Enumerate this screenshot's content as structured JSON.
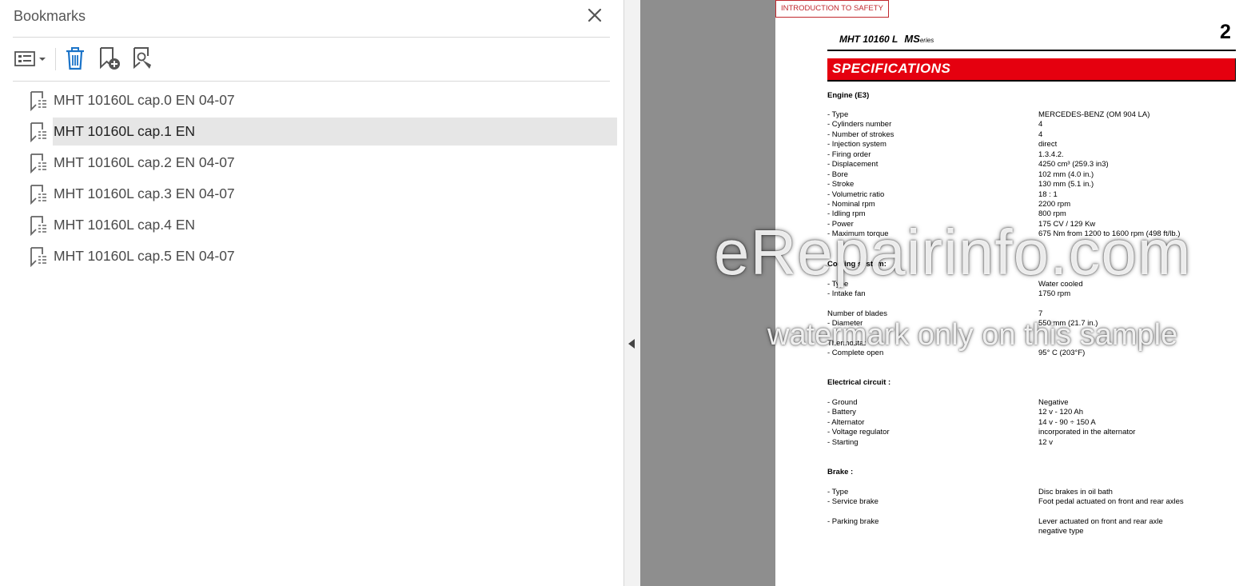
{
  "bookmarks_panel": {
    "title": "Bookmarks",
    "items": [
      {
        "label": "MHT 10160L cap.0 EN 04-07"
      },
      {
        "label": "MHT 10160L cap.1 EN"
      },
      {
        "label": "MHT 10160L cap.2 EN 04-07"
      },
      {
        "label": "MHT 10160L cap.3 EN 04-07"
      },
      {
        "label": "MHT 10160L cap.4 EN"
      },
      {
        "label": "MHT 10160L cap.5 EN 04-07"
      }
    ],
    "selected_index": 1
  },
  "page": {
    "section_tag": "INTRODUCTION TO SAFETY",
    "model": "MHT 10160 L",
    "series_prefix": "MS",
    "series_suffix": "eries",
    "page_number": "2",
    "banner": "SPECIFICATIONS",
    "engine": {
      "heading": "Engine (E3)",
      "rows": [
        {
          "k": "- Type",
          "v": "MERCEDES-BENZ (OM 904 LA)"
        },
        {
          "k": "- Cylinders number",
          "v": "4"
        },
        {
          "k": "- Number of strokes",
          "v": "4"
        },
        {
          "k": "- Injection system",
          "v": "direct"
        },
        {
          "k": "- Firing order",
          "v": "1.3.4.2."
        },
        {
          "k": "- Displacement",
          "v": "4250 cm³   (259.3 in3)"
        },
        {
          "k": "- Bore",
          "v": "102 mm   (4.0 in.)"
        },
        {
          "k": "- Stroke",
          "v": "130 mm   (5.1 in.)"
        },
        {
          "k": "- Volumetric ratio",
          "v": "18 : 1"
        },
        {
          "k": "- Nominal rpm",
          "v": "2200 rpm"
        },
        {
          "k": "- Idling rpm",
          "v": "800 rpm"
        },
        {
          "k": "- Power",
          "v": "175 CV / 129 Kw"
        },
        {
          "k": "- Maximum torque",
          "v": "675 Nm  from 1200 to 1600 rpm    (498 ft/lb.)"
        }
      ]
    },
    "cooling": {
      "heading": "Cooling system:",
      "rows": [
        {
          "k": "- Type",
          "v": "Water cooled"
        },
        {
          "k": "- Intake fan",
          "v": "1750 rpm"
        },
        {
          "k": "Number of blades",
          "v": "7"
        },
        {
          "k": "- Diameter",
          "v": "550 mm  (21.7 in.)"
        },
        {
          "k": "Thermostat",
          "v": ""
        },
        {
          "k": "- Complete open",
          "v": "95° C    (203°F)"
        }
      ]
    },
    "electrical": {
      "heading": "Electrical circuit :",
      "rows": [
        {
          "k": "- Ground",
          "v": "Negative"
        },
        {
          "k": "- Battery",
          "v": "12 v - 120 Ah"
        },
        {
          "k": "- Alternator",
          "v": "14 v - 90 ÷ 150 A"
        },
        {
          "k": "- Voltage regulator",
          "v": "incorporated in the alternator"
        },
        {
          "k": "- Starting",
          "v": "12 v"
        }
      ]
    },
    "brake": {
      "heading": "Brake :",
      "rows": [
        {
          "k": "- Type",
          "v": "Disc brakes in oil bath"
        },
        {
          "k": "- Service brake",
          "v": "Foot pedal actuated on front and rear axles"
        },
        {
          "k": "- Parking brake",
          "v": "Lever actuated on front and rear axle"
        },
        {
          "k": "",
          "v": "negative type"
        }
      ]
    }
  },
  "watermark": {
    "main": "eRepairinfo.com",
    "sub": "watermark only on this sample"
  }
}
